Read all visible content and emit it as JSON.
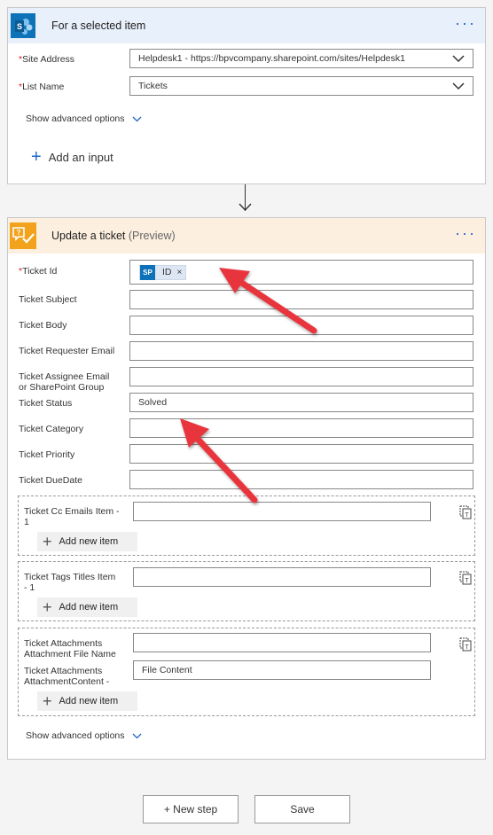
{
  "card1": {
    "title": "For a selected item",
    "dots": "···",
    "site_address": {
      "label": "Site Address",
      "value": "Helpdesk1 - https://bpvcompany.sharepoint.com/sites/Helpdesk1"
    },
    "list_name": {
      "label": "List Name",
      "value": "Tickets"
    },
    "required_mark": "*",
    "advanced": "Show advanced options",
    "add_input": "Add an input",
    "add_input_plus": "+"
  },
  "card2": {
    "title": "Update a ticket",
    "subtitle": "(Preview)",
    "dots": "···",
    "required_mark": "*",
    "fields": {
      "ticket_id": {
        "label": "Ticket Id",
        "token_icon": "SP",
        "token_text": "ID",
        "token_remove": "×"
      },
      "subject": {
        "label": "Ticket Subject",
        "value": ""
      },
      "body": {
        "label": "Ticket Body",
        "value": ""
      },
      "requester": {
        "label": "Ticket Requester Email",
        "value": ""
      },
      "assignee": {
        "label_line1": "Ticket Assignee Email",
        "label_line2": "or SharePoint Group",
        "value": ""
      },
      "status": {
        "label": "Ticket Status",
        "value": "Solved"
      },
      "category": {
        "label": "Ticket Category",
        "value": ""
      },
      "priority": {
        "label": "Ticket Priority",
        "value": ""
      },
      "duedate": {
        "label": "Ticket DueDate",
        "value": ""
      }
    },
    "arrays": {
      "cc": {
        "label_line1": "Ticket Cc Emails Item -",
        "label_line2": "1",
        "add": "Add new item"
      },
      "tags": {
        "label_line1": "Ticket Tags Titles Item",
        "label_line2": "- 1",
        "add": "Add new item"
      },
      "attach": {
        "label1_line1": "Ticket Attachments",
        "label1_line2": "Attachment File Name",
        "label2_line1": "Ticket Attachments",
        "label2_line2": "AttachmentContent -",
        "content_placeholder": "File Content",
        "add": "Add new item"
      }
    },
    "add_plus": "+",
    "advanced": "Show advanced options"
  },
  "footer": {
    "new_step": "+ New step",
    "save": "Save"
  },
  "colors": {
    "accent": "#2266cc",
    "required": "#d42020",
    "annotation_arrow": "#e8343c",
    "sharepoint": "#0e72b8",
    "helpdesk": "#f2a21b"
  },
  "icons": [
    "sharepoint-icon",
    "helpdesk-icon",
    "more-options-icon",
    "chevron-down-icon",
    "plus-icon",
    "copy-icon",
    "arrow-down-icon"
  ]
}
